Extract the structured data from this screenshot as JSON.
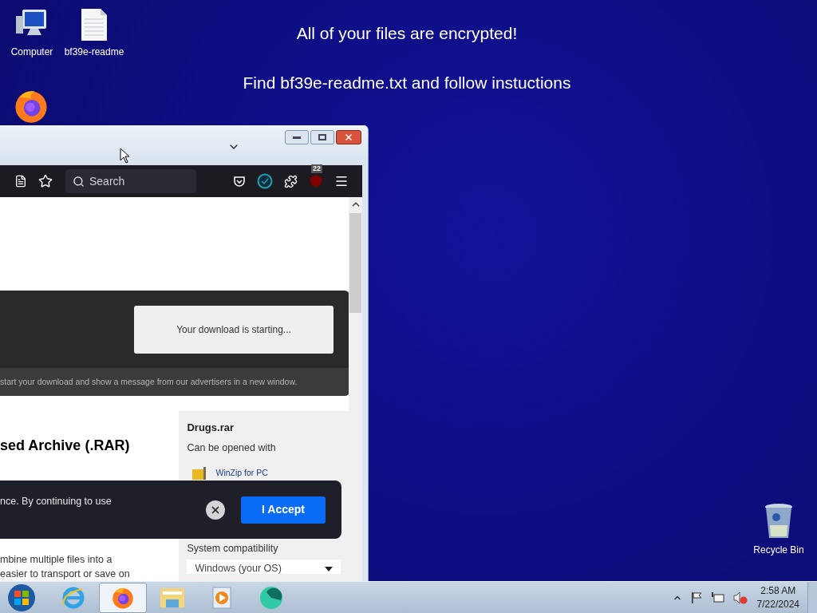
{
  "desktop_message": {
    "title": "All of your files are encrypted!",
    "instruction": "Find bf39e-readme.txt and follow instuctions"
  },
  "desktop_icons": [
    {
      "kind": "computer",
      "label": "Computer"
    },
    {
      "kind": "document",
      "label": "bf39e-readme"
    }
  ],
  "firefox_shortcut": {
    "kind": "firefox"
  },
  "recycle_bin": {
    "label": "Recycle Bin"
  },
  "browser": {
    "search": {
      "placeholder": "Search"
    },
    "extension_badge": "22",
    "download_banner": {
      "status": "Your download is starting...",
      "note": "start your download and show a message from our advertisers in a new window."
    },
    "heading": "sed Archive (.RAR)",
    "body_lines": [
      "mbine multiple files into a",
      "easier to transport or save on"
    ],
    "sidebar": {
      "file_name": "Drugs.rar",
      "opened_with": "Can be opened with",
      "app_link": "WinZip for PC",
      "compatibility_label": "System compatibility",
      "os_select": "Windows (your OS)"
    },
    "cookie_banner": {
      "text": "nce. By continuing to use",
      "accept": "I Accept"
    }
  },
  "taskbar": {
    "apps": [
      {
        "kind": "ie",
        "selected": false
      },
      {
        "kind": "firefox",
        "selected": true
      },
      {
        "kind": "explorer",
        "selected": false
      },
      {
        "kind": "media",
        "selected": false
      },
      {
        "kind": "app",
        "selected": false
      }
    ],
    "time": "2:58 AM",
    "date": "7/22/2024",
    "volume_muted": true
  }
}
